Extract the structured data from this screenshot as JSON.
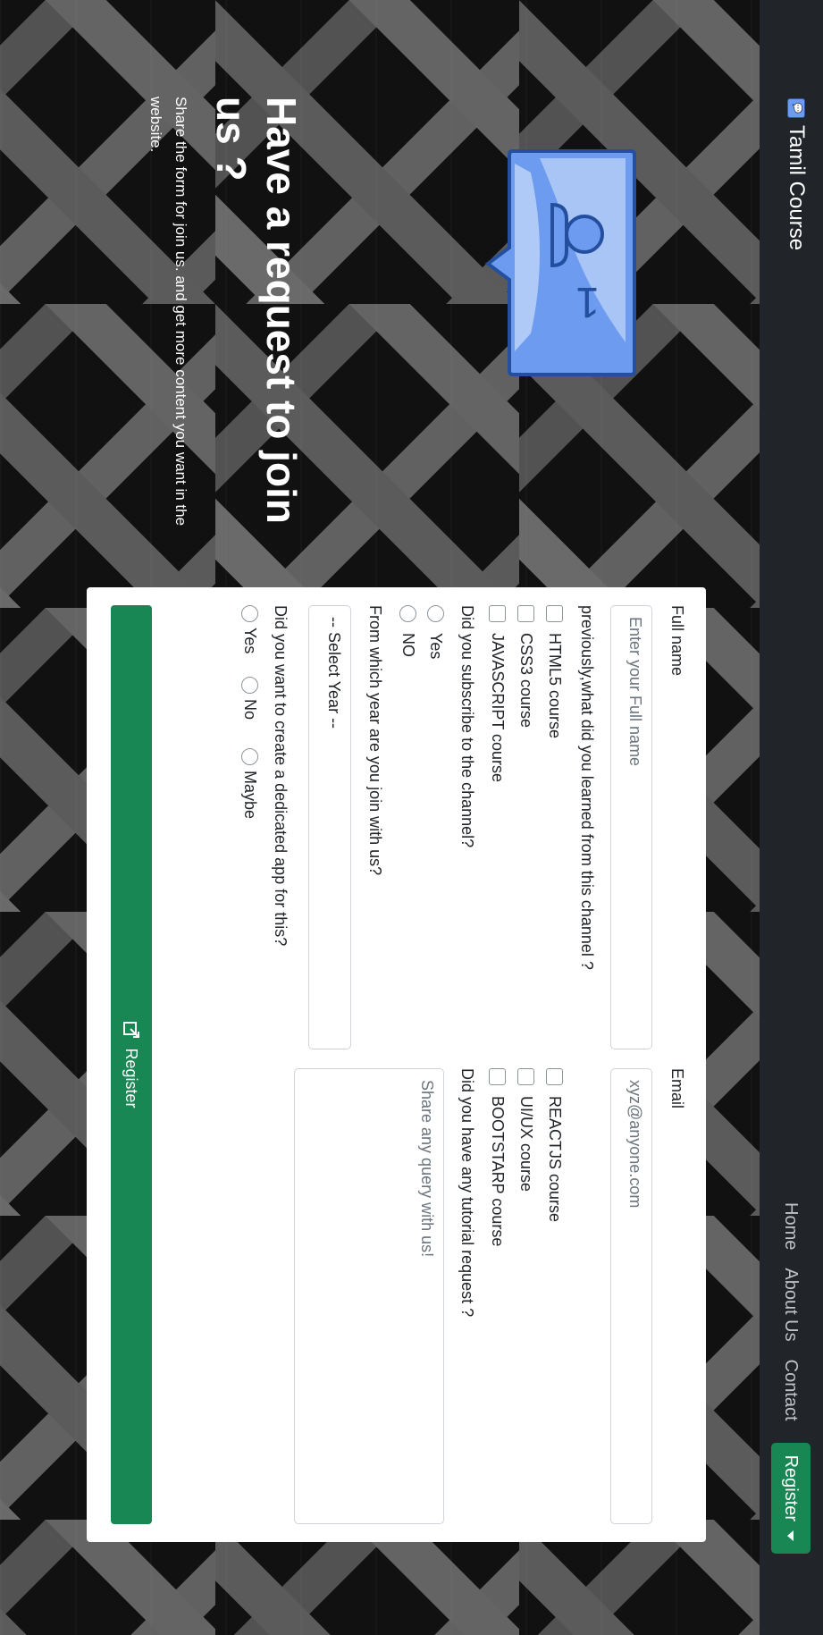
{
  "navbar": {
    "brand": "Tamil Course",
    "links": [
      "Home",
      "About Us",
      "Contact"
    ],
    "register_label": "Register"
  },
  "hero": {
    "title": "Have a request to join us ?",
    "text": "Share the form for join us. and get more content you want in the website.",
    "icon": "chat-user-badge-icon",
    "icon_badge": "1"
  },
  "form": {
    "full_name_label": "Full name",
    "full_name_placeholder": "Enter your Full name",
    "email_label": "Email",
    "email_placeholder": "xyz@anyone.com",
    "courses_label": "previously,what did you learned from this channel ?",
    "courses": [
      "HTML5 course",
      "CSS3 course",
      "JAVASCRIPT course",
      "REACTJS course",
      "UI/UX course",
      "BOOTSTARP course"
    ],
    "subscribe_label": "Did you subscribe to the channel?",
    "subscribe_options": [
      "Yes",
      "NO"
    ],
    "tutorial_label": "Did you have any tutorial request ?",
    "tutorial_placeholder": "Share any query with us!",
    "year_label": "From which year are you join with us?",
    "year_selected": "-- Select Year --",
    "app_label": "Did you want to create a dedicated app for this?",
    "app_options": [
      "Yes",
      "No",
      "Maybe"
    ],
    "submit_label": "Register",
    "submit_icon": "external-link-icon"
  },
  "colors": {
    "navbar": "#212529",
    "primary_green": "#198754",
    "icon_blue": "#6d9bef"
  }
}
